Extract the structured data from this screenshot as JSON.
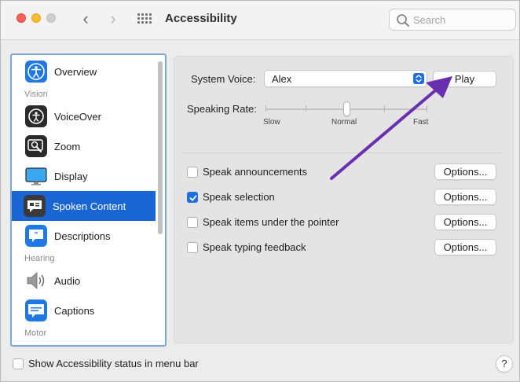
{
  "window": {
    "title": "Accessibility",
    "nav_back": "‹",
    "nav_forward": "›"
  },
  "search": {
    "placeholder": "Search"
  },
  "sidebar": {
    "items": [
      {
        "label": "Overview",
        "icon": "accessibility-icon",
        "selected": false
      },
      {
        "label": "VoiceOver",
        "icon": "voiceover-icon",
        "selected": false
      },
      {
        "label": "Zoom",
        "icon": "zoom-icon",
        "selected": false
      },
      {
        "label": "Display",
        "icon": "display-icon",
        "selected": false
      },
      {
        "label": "Spoken Content",
        "icon": "spoken-content-icon",
        "selected": true
      },
      {
        "label": "Descriptions",
        "icon": "descriptions-icon",
        "selected": false
      },
      {
        "label": "Audio",
        "icon": "audio-icon",
        "selected": false
      },
      {
        "label": "Captions",
        "icon": "captions-icon",
        "selected": false
      }
    ],
    "sections": {
      "vision": "Vision",
      "hearing": "Hearing",
      "motor": "Motor"
    }
  },
  "main": {
    "system_voice_label": "System Voice:",
    "system_voice_value": "Alex",
    "play_label": "Play",
    "speaking_rate_label": "Speaking Rate:",
    "speaking_rate": {
      "slow": "Slow",
      "normal": "Normal",
      "fast": "Fast",
      "level": 0.5
    },
    "options": [
      {
        "label": "Speak announcements",
        "checked": false,
        "button": "Options..."
      },
      {
        "label": "Speak selection",
        "checked": true,
        "button": "Options..."
      },
      {
        "label": "Speak items under the pointer",
        "checked": false,
        "button": "Options..."
      },
      {
        "label": "Speak typing feedback",
        "checked": false,
        "button": "Options..."
      }
    ]
  },
  "footer": {
    "status_label": "Show Accessibility status in menu bar",
    "status_checked": false,
    "help": "?"
  },
  "colors": {
    "accent": "#1f6fe0",
    "selection": "#1a65d4",
    "annotation_arrow": "#6a2fb0"
  }
}
